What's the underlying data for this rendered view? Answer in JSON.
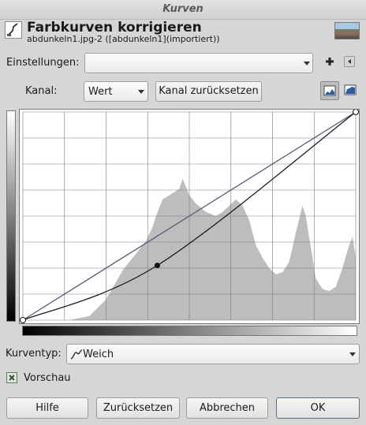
{
  "window": {
    "title": "Kurven"
  },
  "header": {
    "title": "Farbkurven korrigieren",
    "subtitle": "abdunkeln1.jpg-2 ([abdunkeln1](importiert))"
  },
  "settings": {
    "label": "Einstellungen:",
    "value": ""
  },
  "channel": {
    "label": "Kanal:",
    "value": "Wert",
    "reset_label": "Kanal zurücksetzen"
  },
  "curve_type": {
    "label": "Kurventyp:",
    "value": "Weich"
  },
  "preview": {
    "label": "Vorschau",
    "checked": true
  },
  "buttons": {
    "help": "Hilfe",
    "reset": "Zurücksetzen",
    "cancel": "Abbrechen",
    "ok": "OK"
  },
  "curve": {
    "input_domain": [
      0,
      255
    ],
    "control_points": [
      [
        0,
        0
      ],
      [
        103,
        67
      ],
      [
        255,
        255
      ]
    ]
  },
  "colors": {
    "curve": "#1a1a1a",
    "diagonal": "#5a5a78",
    "histogram": "#bdbdbd",
    "grid": "#7a7a7a"
  }
}
